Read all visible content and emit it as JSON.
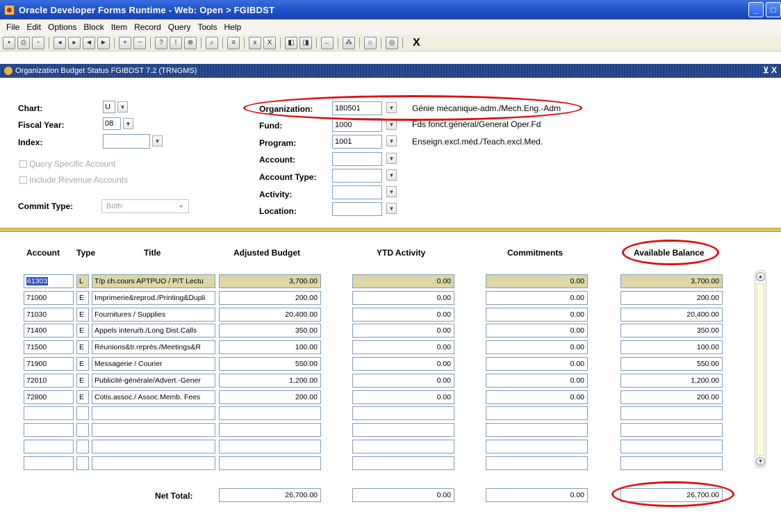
{
  "window": {
    "title": "Oracle Developer Forms Runtime - Web:  Open > FGIBDST",
    "buttons": [
      "_",
      "□"
    ]
  },
  "menu": [
    "File",
    "Edit",
    "Options",
    "Block",
    "Item",
    "Record",
    "Query",
    "Tools",
    "Help"
  ],
  "toolbar": {
    "exit_label": "X"
  },
  "form": {
    "title": "Organization Budget Status  FGIBDST  7.2  (TRNGMS)",
    "close_label": "⊻ X"
  },
  "key": {
    "chart_label": "Chart:",
    "chart_value": "U",
    "fiscal_label": "Fiscal Year:",
    "fiscal_value": "08",
    "index_label": "Index:",
    "index_value": "",
    "query_specific_label": "Query Specific Account",
    "include_revenue_label": "Include Revenue Accounts",
    "commit_label": "Commit Type:",
    "commit_value": "Both",
    "org_label": "Organization:",
    "org_value": "180501",
    "org_desc": "Génie mécanique-adm./Mech.Eng.-Adm",
    "fund_label": "Fund:",
    "fund_value": "1000",
    "fund_desc": "Fds fonct.général/General Oper.Fd",
    "program_label": "Program:",
    "program_value": "1001",
    "program_desc": "Enseign.excl.méd./Teach.excl.Med.",
    "account_label": "Account:",
    "account_value": "",
    "account_type_label": "Account Type:",
    "account_type_value": "",
    "activity_label": "Activity:",
    "activity_value": "",
    "location_label": "Location:",
    "location_value": ""
  },
  "table": {
    "headers": {
      "account": "Account",
      "type": "Type",
      "title": "Title",
      "adjusted": "Adjusted Budget",
      "ytd": "YTD Activity",
      "commitments": "Commitments",
      "available": "Available Balance"
    },
    "rows": [
      {
        "account": "61303",
        "type": "L",
        "title": "T/p ch.cours APTPUO / P/T Lectu",
        "adjusted": "3,700.00",
        "ytd": "0.00",
        "commitments": "0.00",
        "available": "3,700.00"
      },
      {
        "account": "71000",
        "type": "E",
        "title": "Imprimerie&reprod./Printing&Dupli",
        "adjusted": "200.00",
        "ytd": "0.00",
        "commitments": "0.00",
        "available": "200.00"
      },
      {
        "account": "71030",
        "type": "E",
        "title": "Fournitures / Supplies",
        "adjusted": "20,400.00",
        "ytd": "0.00",
        "commitments": "0.00",
        "available": "20,400.00"
      },
      {
        "account": "71400",
        "type": "E",
        "title": "Appels  interurb./Long Dist.Calls",
        "adjusted": "350.00",
        "ytd": "0.00",
        "commitments": "0.00",
        "available": "350.00"
      },
      {
        "account": "71500",
        "type": "E",
        "title": "Réunions&tr.représ./Meetings&R",
        "adjusted": "100.00",
        "ytd": "0.00",
        "commitments": "0.00",
        "available": "100.00"
      },
      {
        "account": "71900",
        "type": "E",
        "title": "Messagerie / Courier",
        "adjusted": "550.00",
        "ytd": "0.00",
        "commitments": "0.00",
        "available": "550.00"
      },
      {
        "account": "72010",
        "type": "E",
        "title": "Publicité-générale/Advert.-Gener",
        "adjusted": "1,200.00",
        "ytd": "0.00",
        "commitments": "0.00",
        "available": "1,200.00"
      },
      {
        "account": "72800",
        "type": "E",
        "title": "Cotis.assoc./ Assoc.Memb. Fees",
        "adjusted": "200.00",
        "ytd": "0.00",
        "commitments": "0.00",
        "available": "200.00"
      },
      {
        "account": "",
        "type": "",
        "title": "",
        "adjusted": "",
        "ytd": "",
        "commitments": "",
        "available": ""
      },
      {
        "account": "",
        "type": "",
        "title": "",
        "adjusted": "",
        "ytd": "",
        "commitments": "",
        "available": ""
      },
      {
        "account": "",
        "type": "",
        "title": "",
        "adjusted": "",
        "ytd": "",
        "commitments": "",
        "available": ""
      },
      {
        "account": "",
        "type": "",
        "title": "",
        "adjusted": "",
        "ytd": "",
        "commitments": "",
        "available": ""
      }
    ],
    "net_total_label": "Net Total:",
    "net_total": {
      "adjusted": "26,700.00",
      "ytd": "0.00",
      "commitments": "0.00",
      "available": "26,700.00"
    }
  }
}
